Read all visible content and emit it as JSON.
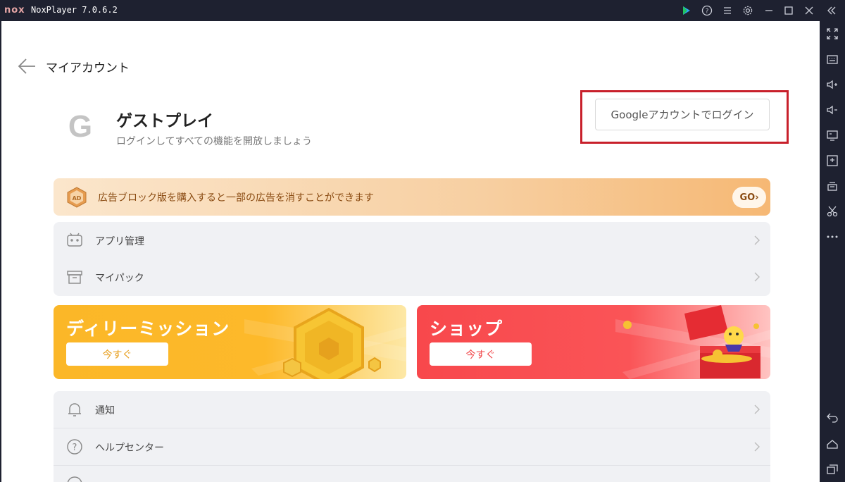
{
  "window": {
    "logo": "nox",
    "title": "NoxPlayer 7.0.6.2",
    "controls": [
      "play-store-icon",
      "help-icon",
      "menu-icon",
      "settings-icon",
      "minimize-icon",
      "maximize-icon",
      "close-icon",
      "collapse-icon"
    ]
  },
  "sidebar": {
    "tools": [
      "fullscreen-icon",
      "keyboard-icon",
      "volume-up-icon",
      "volume-down-icon",
      "screen-icon",
      "add-apk-icon",
      "multi-instance-icon",
      "screenshot-scissors-icon",
      "more-icon"
    ],
    "nav": [
      "back-icon",
      "home-icon",
      "recent-apps-icon"
    ]
  },
  "header": {
    "title": "マイアカウント"
  },
  "profile": {
    "avatar_letter": "G",
    "name": "ゲストプレイ",
    "subtitle": "ログインしてすべての機能を開放しましょう",
    "login_button": "Googleアカウントでログイン"
  },
  "ad_banner": {
    "icon_text": "AD",
    "text": "広告ブロック版を購入すると一部の広告を消すことができます",
    "go_label": "GO"
  },
  "menu_group_1": [
    {
      "icon": "android-app-icon",
      "label": "アプリ管理"
    },
    {
      "icon": "box-icon",
      "label": "マイパック"
    }
  ],
  "cards": {
    "daily": {
      "title": "ディリーミッション",
      "button": "今すぐ"
    },
    "shop": {
      "title": "ショップ",
      "button": "今すぐ"
    }
  },
  "menu_group_2": [
    {
      "icon": "bell-icon",
      "label": "通知"
    },
    {
      "icon": "question-circle-icon",
      "label": "ヘルプセンター"
    },
    {
      "icon": "info-icon",
      "label": ""
    }
  ],
  "colors": {
    "accent_red": "#c8202b",
    "daily_orange": "#fbb728",
    "shop_red": "#f8484c"
  }
}
